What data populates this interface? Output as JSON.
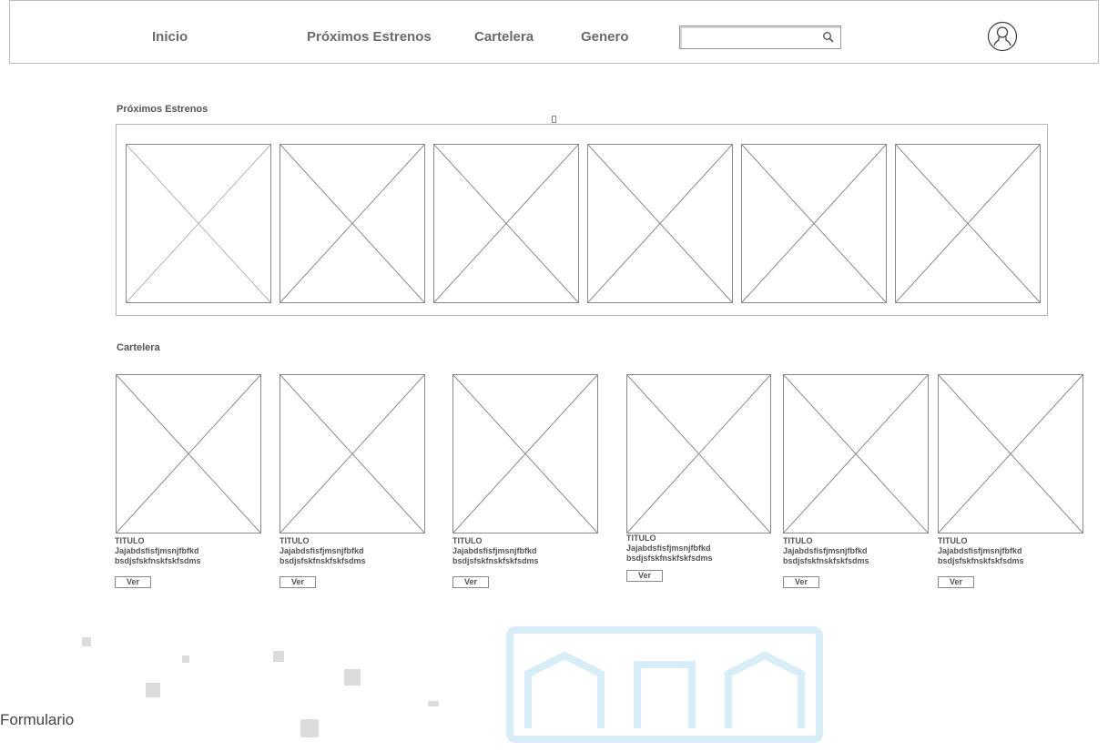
{
  "nav": {
    "home": "Inicio",
    "upcoming": "Próximos Estrenos",
    "billboard": "Cartelera",
    "genre": "Genero",
    "search_placeholder": "",
    "search_icon": "search-icon",
    "user_icon": "user-icon"
  },
  "upcoming": {
    "title": "Próximos Estrenos",
    "item_count": 6
  },
  "billboard": {
    "title": "Cartelera",
    "movies": [
      {
        "title": "TITULO",
        "line1": "Jajabdsfisfjmsnjfbfkd",
        "line2": "bsdjsfskfnskfskfsdms",
        "button": "Ver"
      },
      {
        "title": "TITULO",
        "line1": "Jajabdsfisfjmsnjfbfkd",
        "line2": "bsdjsfskfnskfskfsdms",
        "button": "Ver"
      },
      {
        "title": "TITULO",
        "line1": "Jajabdsfisfjmsnjfbfkd",
        "line2": "bsdjsfskfnskfskfsdms",
        "button": "Ver"
      },
      {
        "title": "TITULO",
        "line1": "Jajabdsfisfjmsnjfbfkd",
        "line2": "bsdjsfskfnskfskfsdms",
        "button": "Ver"
      },
      {
        "title": "TITULO",
        "line1": "Jajabdsfisfjmsnjfbfkd",
        "line2": "bsdjsfskfnskfskfsdms",
        "button": "Ver"
      },
      {
        "title": "TITULO",
        "line1": "Jajabdsfisfjmsnjfbfkd",
        "line2": "bsdjsfskfnskfskfsdms",
        "button": "Ver"
      }
    ]
  },
  "footer": {
    "form_label": "Formulario"
  },
  "colors": {
    "border": "#bdbdbd",
    "text": "#555555",
    "watermark": "#cfeaf5"
  }
}
